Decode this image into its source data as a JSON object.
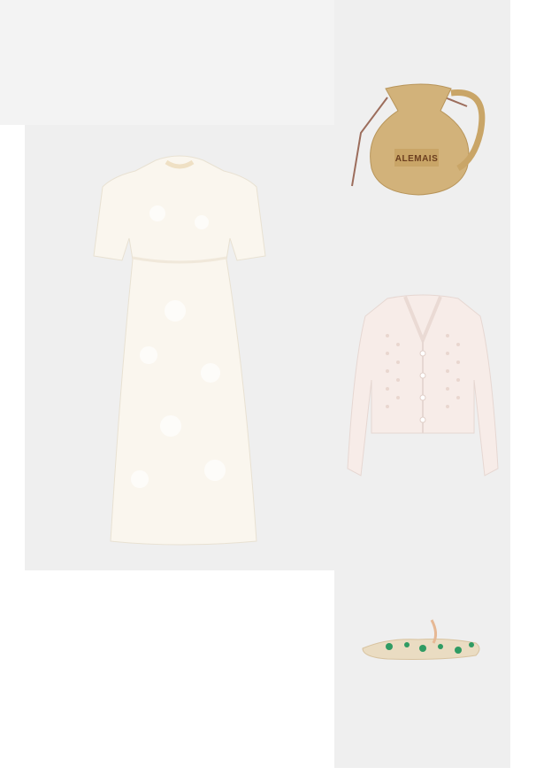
{
  "products": [
    {
      "name": "white-lace-midi-dress"
    },
    {
      "name": "woven-jug-bag",
      "brand_label": "ALEMAIS"
    },
    {
      "name": "pointelle-knit-cardigan"
    },
    {
      "name": "embroidered-ballet-flats"
    }
  ],
  "colors": {
    "tile_bg": "#efefef",
    "dress": "#faf6ee",
    "bag": "#d2b27a",
    "cardigan": "#f7ece8",
    "flats": "#eadcc2",
    "embroidery": "#2f9b63"
  }
}
